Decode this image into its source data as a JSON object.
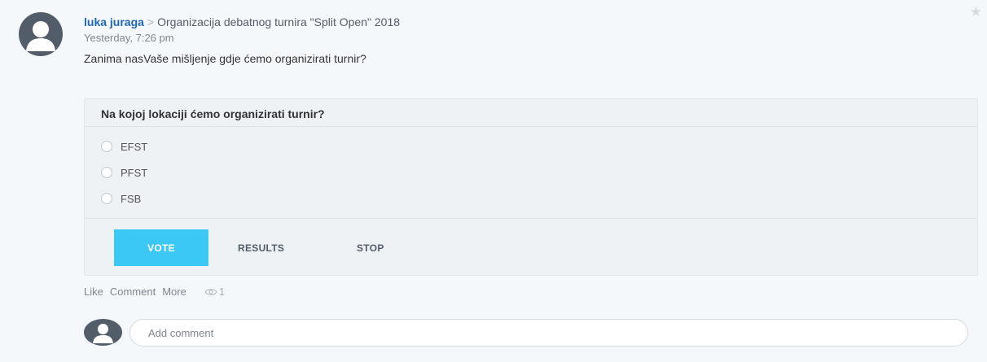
{
  "post": {
    "author": "luka juraga",
    "separator": ">",
    "destination": "Organizacija debatnog turnira \"Split Open\" 2018",
    "timestamp": "Yesterday, 7:26 pm",
    "message": "Zanima nasVaše mišljenje gdje ćemo organizirati turnir?",
    "favorite_icon": "star-icon"
  },
  "poll": {
    "question": "Na kojoj lokaciji ćemo organizirati turnir?",
    "options": [
      {
        "label": "EFST"
      },
      {
        "label": "PFST"
      },
      {
        "label": "FSB"
      }
    ],
    "vote_label": "VOTE",
    "results_label": "RESULTS",
    "stop_label": "STOP",
    "accent_color": "#3bc8f5"
  },
  "actions": {
    "like": "Like",
    "comment": "Comment",
    "more": "More",
    "views_icon": "eye-icon",
    "views_count": "1"
  },
  "comment": {
    "placeholder": "Add comment"
  }
}
